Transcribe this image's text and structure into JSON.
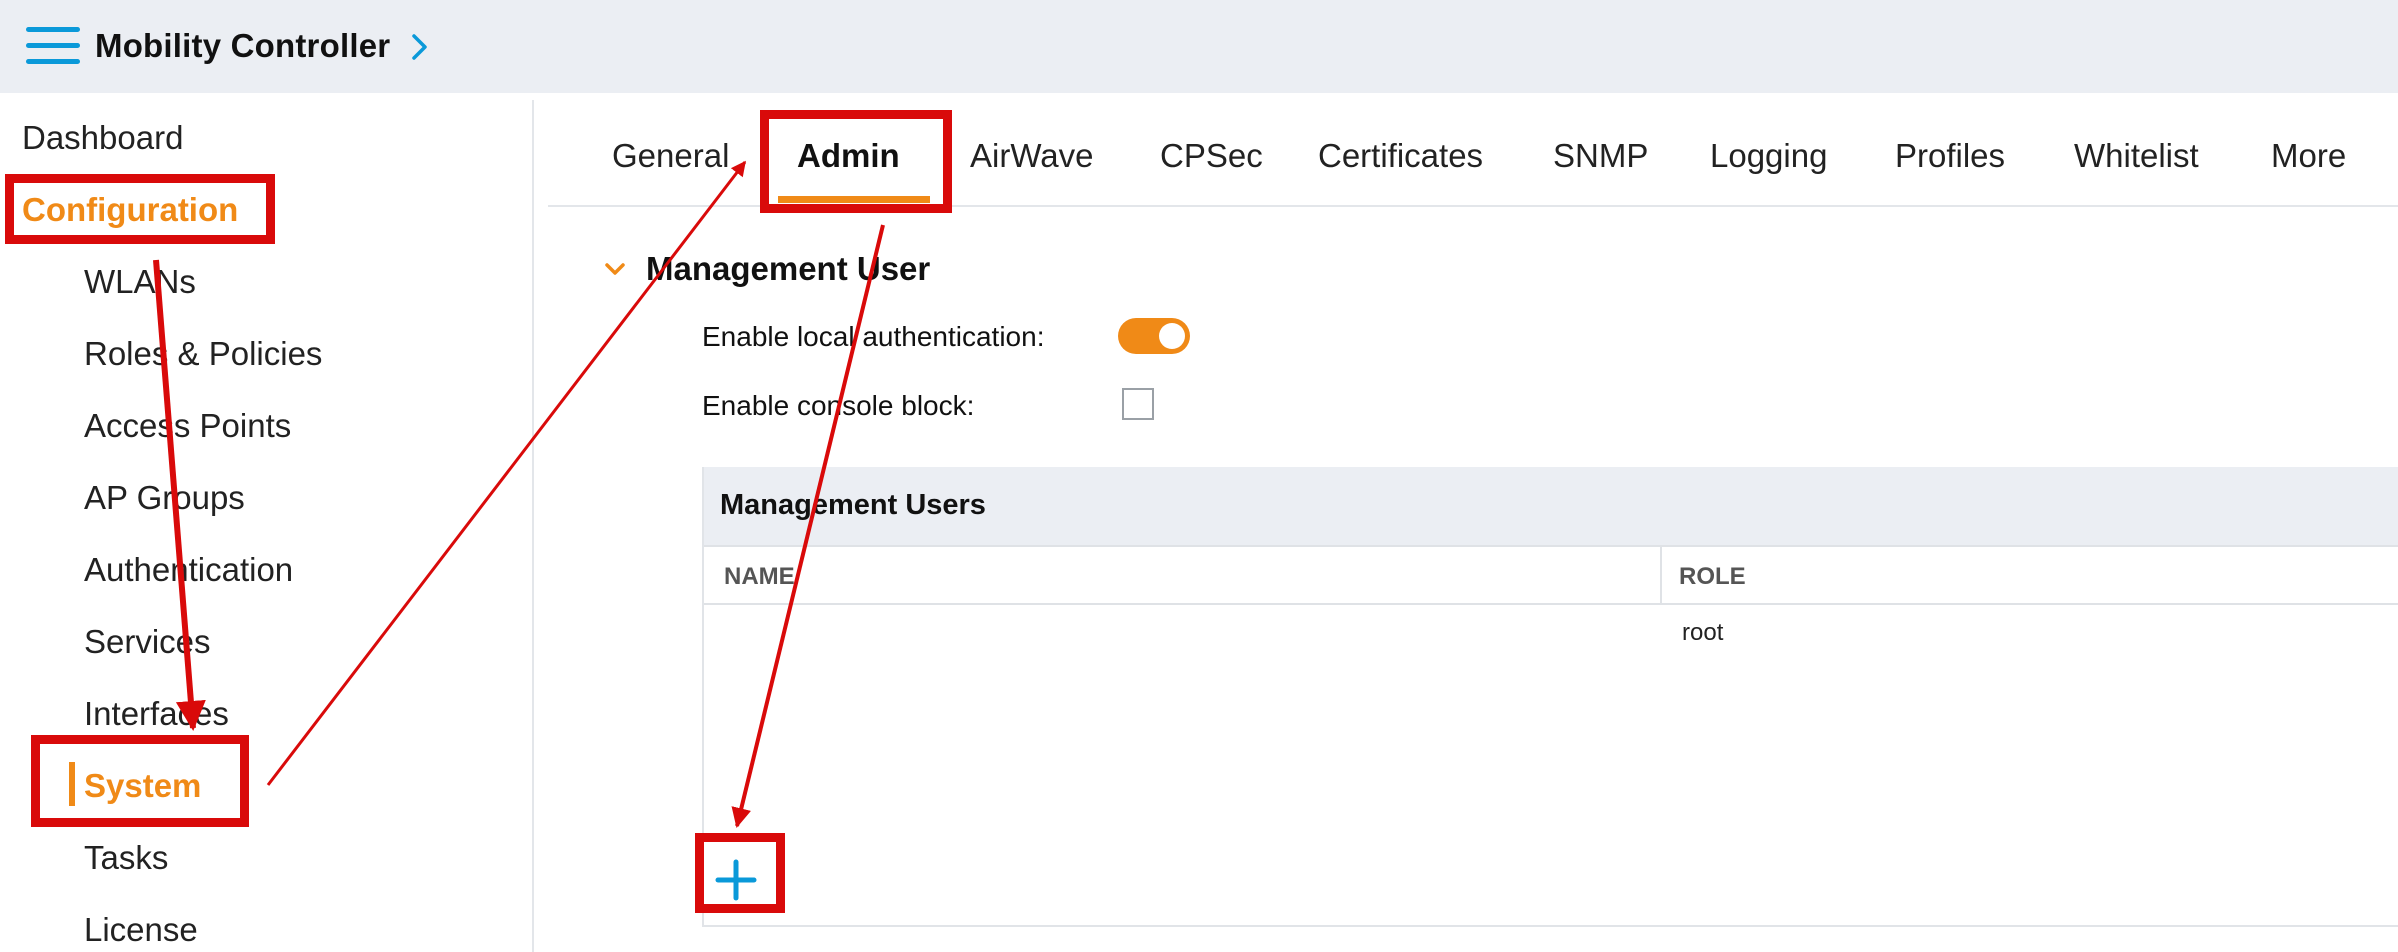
{
  "header": {
    "title": "Mobility Controller",
    "menu_icon": "hamburger-menu-icon",
    "chevron_icon": "chevron-right-icon"
  },
  "sidebar": {
    "items": [
      {
        "label": "Dashboard"
      },
      {
        "label": "Configuration"
      },
      {
        "label": "WLANs"
      },
      {
        "label": "Roles & Policies"
      },
      {
        "label": "Access Points"
      },
      {
        "label": "AP Groups"
      },
      {
        "label": "Authentication"
      },
      {
        "label": "Services"
      },
      {
        "label": "Interfaces"
      },
      {
        "label": "System"
      },
      {
        "label": "Tasks"
      },
      {
        "label": "License"
      }
    ]
  },
  "tabs": [
    {
      "label": "General"
    },
    {
      "label": "Admin"
    },
    {
      "label": "AirWave"
    },
    {
      "label": "CPSec"
    },
    {
      "label": "Certificates"
    },
    {
      "label": "SNMP"
    },
    {
      "label": "Logging"
    },
    {
      "label": "Profiles"
    },
    {
      "label": "Whitelist"
    },
    {
      "label": "More"
    }
  ],
  "section": {
    "title": "Management User",
    "local_auth_label": "Enable local authentication:",
    "local_auth_enabled": true,
    "console_block_label": "Enable console block:",
    "console_block_checked": false
  },
  "table": {
    "title": "Management Users",
    "columns": [
      "NAME",
      "ROLE"
    ],
    "rows": [
      {
        "name": "",
        "role": "root"
      }
    ],
    "add_icon": "plus-icon"
  },
  "colors": {
    "accent": "#f08a17",
    "link": "#0a99d9",
    "annotation": "#d90a0a",
    "header_bg": "#ebeef3"
  }
}
